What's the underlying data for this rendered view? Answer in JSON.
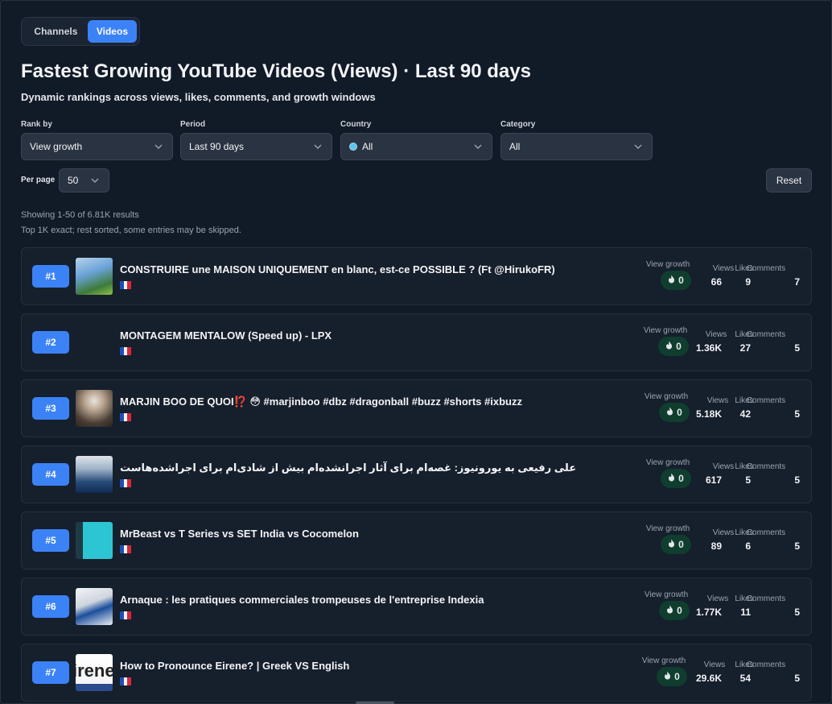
{
  "tabs": {
    "channels": "Channels",
    "videos": "Videos"
  },
  "page_title": "Fastest Growing YouTube Videos (Views) · Last 90 days",
  "subtitle": "Dynamic rankings across views, likes, comments, and growth windows",
  "filters": {
    "rank_by": {
      "label": "Rank by",
      "value": "View growth"
    },
    "period": {
      "label": "Period",
      "value": "Last 90 days"
    },
    "country": {
      "label": "Country",
      "value": "All"
    },
    "category": {
      "label": "Category",
      "value": "All"
    }
  },
  "per_page": {
    "label": "Per page",
    "value": "50"
  },
  "reset_label": "Reset",
  "results_info": "Showing 1-50 of 6.81K results",
  "results_note": "Top 1K exact; rest sorted, some entries may be skipped.",
  "stat_labels": {
    "view_growth": "View growth",
    "views": "Views",
    "likes": "Likes",
    "comments": "Comments"
  },
  "rows": [
    {
      "rank": "#1",
      "title": "CONSTRUIRE une MAISON UNIQUEMENT en blanc, est-ce POSSIBLE ? (Ft @HirukoFR)",
      "growth": "0",
      "views": "66",
      "likes": "9",
      "comments": "7"
    },
    {
      "rank": "#2",
      "title": "MONTAGEM MENTALOW (Speed up) - LPX",
      "growth": "0",
      "views": "1.36K",
      "likes": "27",
      "comments": "5"
    },
    {
      "rank": "#3",
      "title": "MARJIN BOO DE QUOI⁉️ 😳 #marjinboo #dbz #dragonball #buzz #shorts #ixbuzz",
      "growth": "0",
      "views": "5.18K",
      "likes": "42",
      "comments": "5"
    },
    {
      "rank": "#4",
      "title": "علی رفیعی به یورونیوز: غصه‌ام برای آثار اجرانشده‌ام بیش از شادی‌ام برای اجراشده‌هاست",
      "growth": "0",
      "views": "617",
      "likes": "5",
      "comments": "5"
    },
    {
      "rank": "#5",
      "title": "MrBeast vs T Series vs SET India vs Cocomelon",
      "growth": "0",
      "views": "89",
      "likes": "6",
      "comments": "5"
    },
    {
      "rank": "#6",
      "title": "Arnaque : les pratiques commerciales trompeuses de l'entreprise Indexia",
      "growth": "0",
      "views": "1.77K",
      "likes": "11",
      "comments": "5"
    },
    {
      "rank": "#7",
      "title": "How to Pronounce Eirene? | Greek VS English",
      "growth": "0",
      "views": "29.6K",
      "likes": "54",
      "comments": "5",
      "thumb_text": "irene"
    }
  ],
  "colors": {
    "accent": "#3b82f6",
    "growth_pill": "#0f3d2e",
    "background": "#111a27"
  }
}
